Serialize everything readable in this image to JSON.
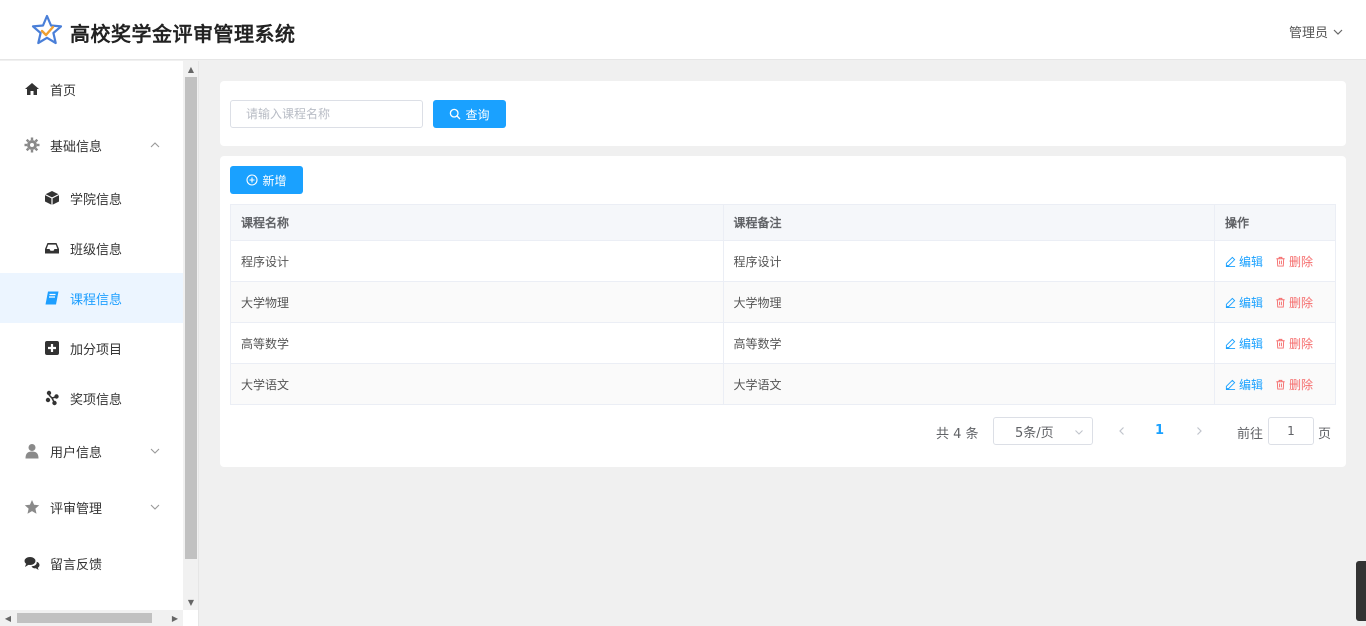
{
  "header": {
    "title": "高校奖学金评审管理系统",
    "user": "管理员"
  },
  "sidebar": {
    "items": [
      {
        "label": "首页",
        "icon": "home-icon"
      },
      {
        "label": "基础信息",
        "icon": "gear-icon",
        "expanded": true
      },
      {
        "label": "学院信息",
        "icon": "cube-icon"
      },
      {
        "label": "班级信息",
        "icon": "inbox-icon"
      },
      {
        "label": "课程信息",
        "icon": "book-icon",
        "active": true
      },
      {
        "label": "加分项目",
        "icon": "plus-square-icon"
      },
      {
        "label": "奖项信息",
        "icon": "award-icon"
      },
      {
        "label": "用户信息",
        "icon": "user-icon",
        "expanded": false
      },
      {
        "label": "评审管理",
        "icon": "star-icon",
        "expanded": false
      },
      {
        "label": "留言反馈",
        "icon": "comments-icon"
      }
    ]
  },
  "search": {
    "placeholder": "请输入课程名称",
    "button_label": "查询"
  },
  "toolbar": {
    "add_label": "新增"
  },
  "table": {
    "headers": [
      "课程名称",
      "课程备注",
      "操作"
    ],
    "rows": [
      {
        "name": "程序设计",
        "remark": "程序设计"
      },
      {
        "name": "大学物理",
        "remark": "大学物理"
      },
      {
        "name": "高等数学",
        "remark": "高等数学"
      },
      {
        "name": "大学语文",
        "remark": "大学语文"
      }
    ],
    "edit_label": "编辑",
    "delete_label": "删除"
  },
  "pagination": {
    "total": "共 4 条",
    "page_size": "5条/页",
    "current_page": "1",
    "goto_label": "前往",
    "goto_value": "1",
    "page_unit": "页"
  },
  "colors": {
    "primary": "#1aa1ff",
    "danger": "#f56c6c",
    "active_bg": "#ecf5ff"
  }
}
